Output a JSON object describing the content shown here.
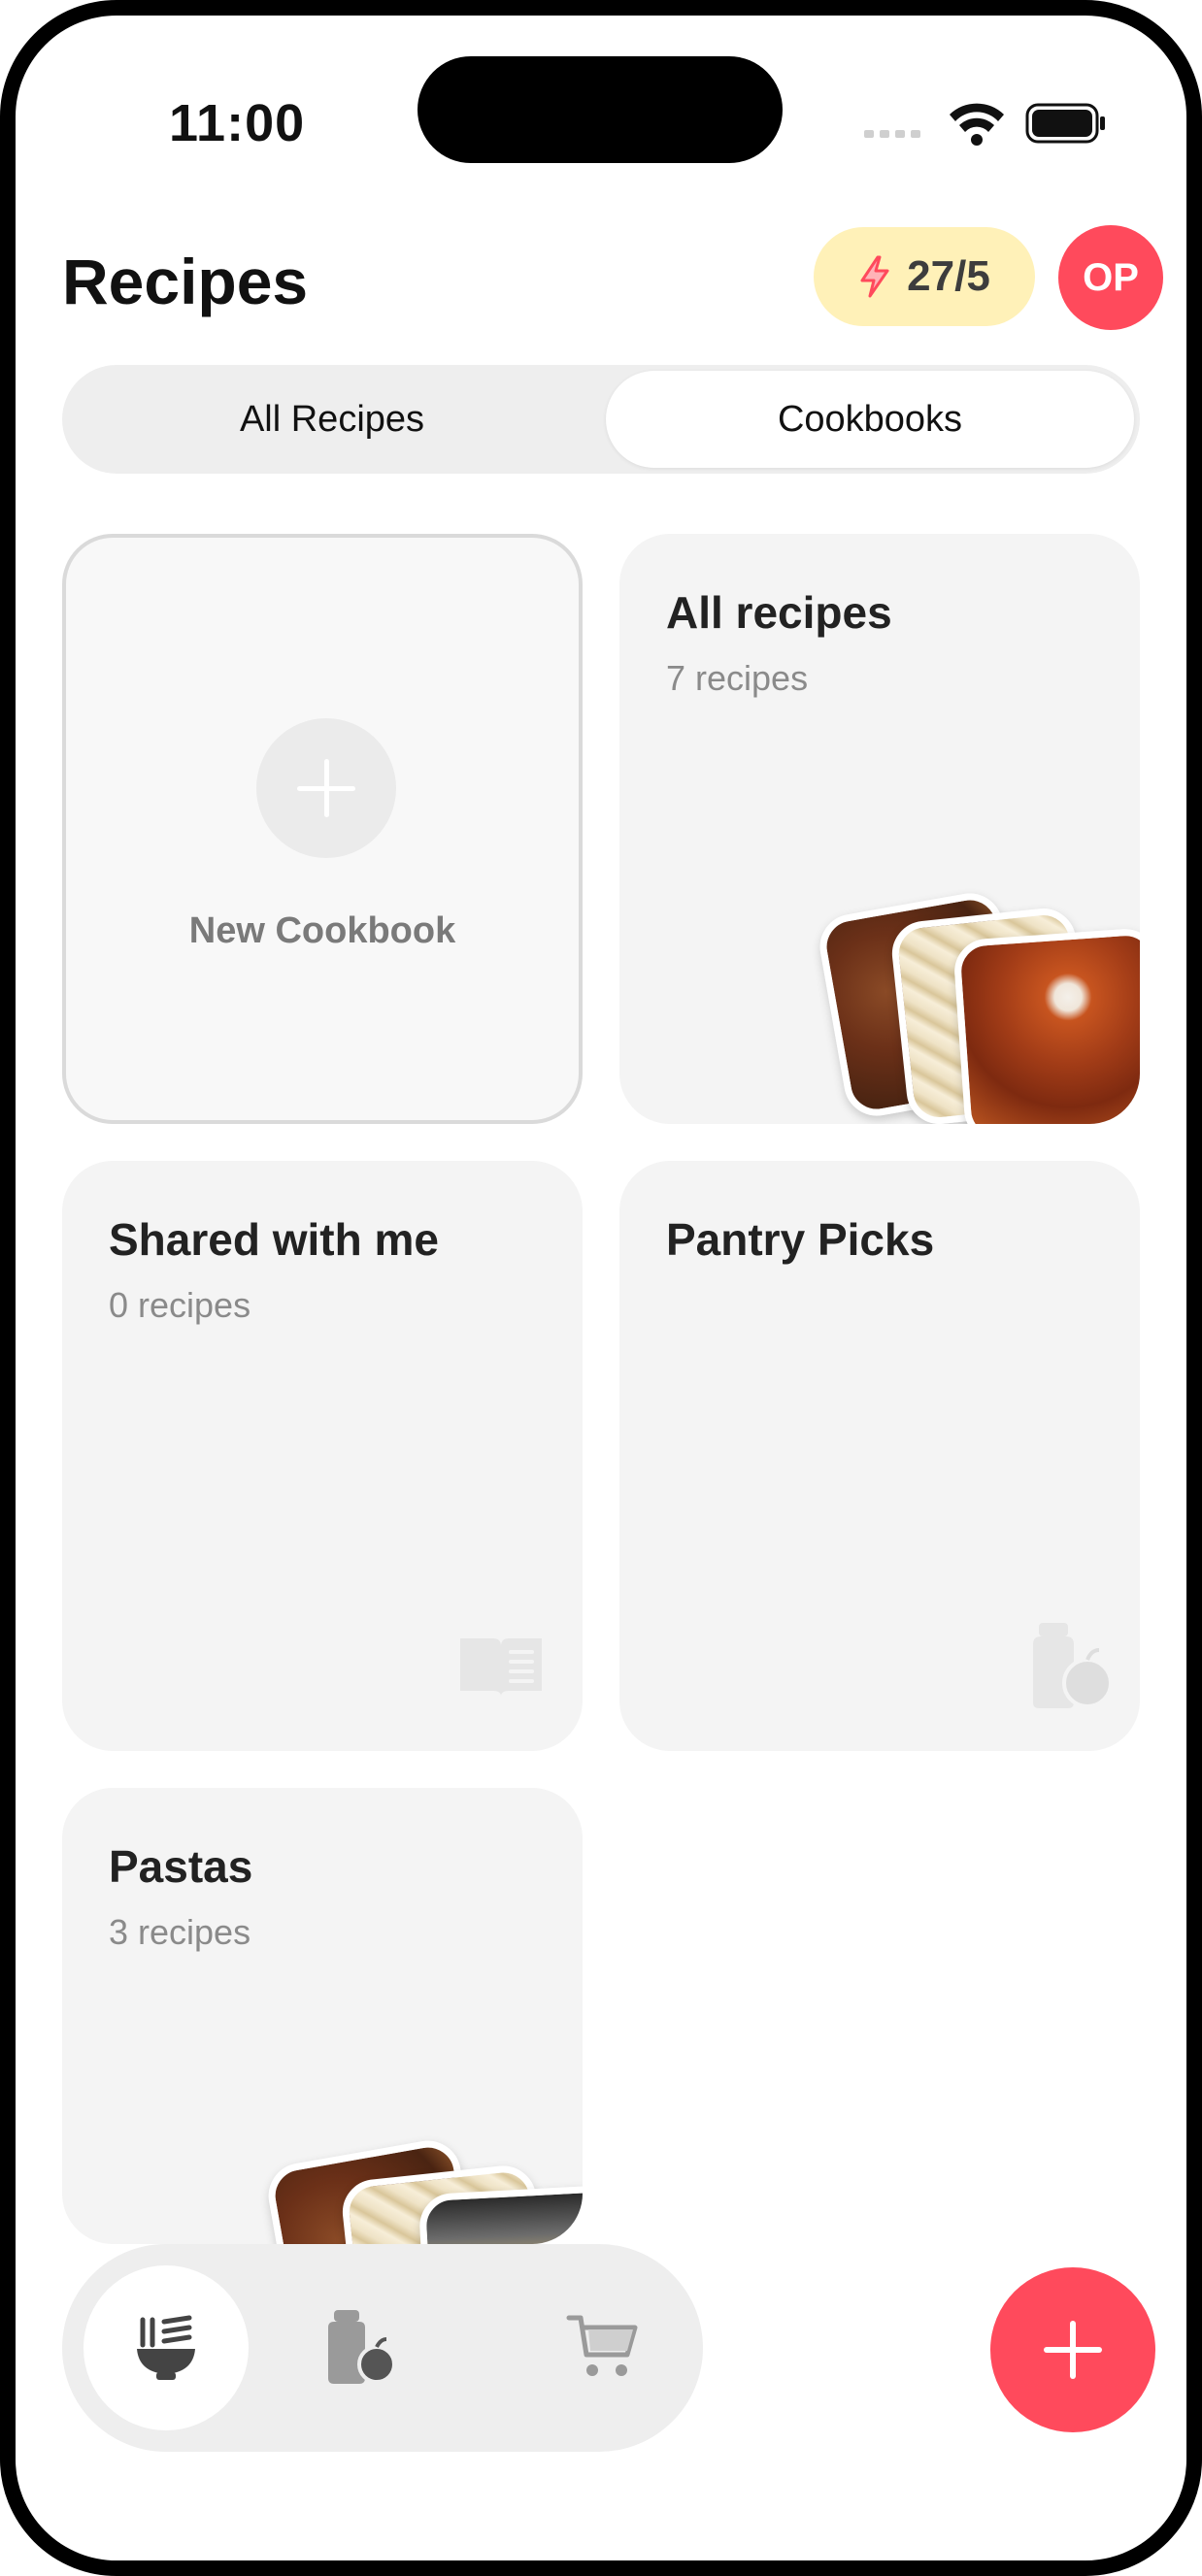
{
  "status_bar": {
    "time": "11:00"
  },
  "header": {
    "title": "Recipes",
    "credits": "27/5",
    "avatar_initials": "OP"
  },
  "colors": {
    "accent": "#ff4a5c",
    "badge_bg": "#fff1b8",
    "card_bg": "#f4f4f4"
  },
  "segments": {
    "all_recipes": "All Recipes",
    "cookbooks": "Cookbooks",
    "selected": "Cookbooks"
  },
  "cookbooks": {
    "new_label": "New Cookbook",
    "all": {
      "title": "All recipes",
      "count": "7 recipes"
    },
    "shared": {
      "title": "Shared with me",
      "count": "0 recipes",
      "icon": "open-book-icon"
    },
    "pantry": {
      "title": "Pantry Picks",
      "icon": "pantry-jar-icon"
    },
    "pastas": {
      "title": "Pastas",
      "count": "3 recipes"
    }
  },
  "tabbar": {
    "items": [
      {
        "icon": "recipes-bowl-icon",
        "active": true
      },
      {
        "icon": "pantry-icon",
        "active": false
      },
      {
        "icon": "shopping-cart-icon",
        "active": false
      }
    ]
  }
}
